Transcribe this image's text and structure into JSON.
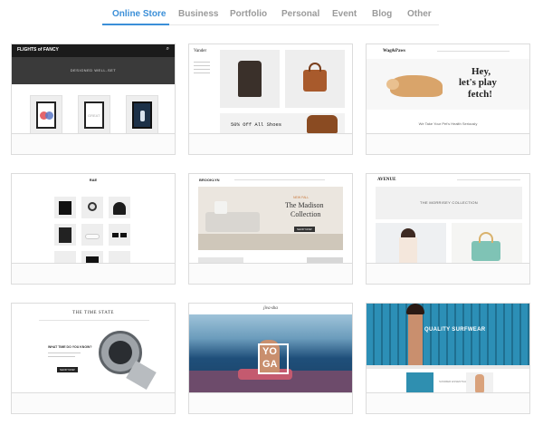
{
  "tabs": [
    {
      "label": "Online Store",
      "active": true
    },
    {
      "label": "Business",
      "active": false
    },
    {
      "label": "Portfolio",
      "active": false
    },
    {
      "label": "Personal",
      "active": false
    },
    {
      "label": "Event",
      "active": false
    },
    {
      "label": "Blog",
      "active": false
    },
    {
      "label": "Other",
      "active": false
    }
  ],
  "colors": {
    "accent": "#3b8fd8",
    "tab_inactive": "#9a9a9a"
  },
  "templates": [
    {
      "brand": "FLIGHTS of FANCY",
      "hero_text": "DESIGNED WELL-SET",
      "poster_text": "GREAT"
    },
    {
      "brand": "Vander",
      "sale_text": "50% Off All Shoes"
    },
    {
      "brand": "Wag&Paws",
      "headline_1": "Hey,",
      "headline_2": "let's play",
      "headline_3": "fetch!",
      "tagline": "We Take Your Pet's Health Seriously"
    },
    {
      "brand": "RAE"
    },
    {
      "brand": "BROOKLYN",
      "kicker": "NEW FALL",
      "headline_1": "The Madison",
      "headline_2": "Collection",
      "cta": "SHOP NOW"
    },
    {
      "brand": "AVENUE",
      "banner": "THE MORRISEY COLLECTION"
    },
    {
      "brand": "THE TIME STATE",
      "question": "WHAT TIME DO YOU KNOW?",
      "cta": "SHOP NOW"
    },
    {
      "brand": "jiva·sha",
      "yoga_1": "YO",
      "yoga_2": "GA"
    },
    {
      "brand": "QUALITY SURFWEAR",
      "sub": "SUMMER ESSENTIALS"
    }
  ]
}
